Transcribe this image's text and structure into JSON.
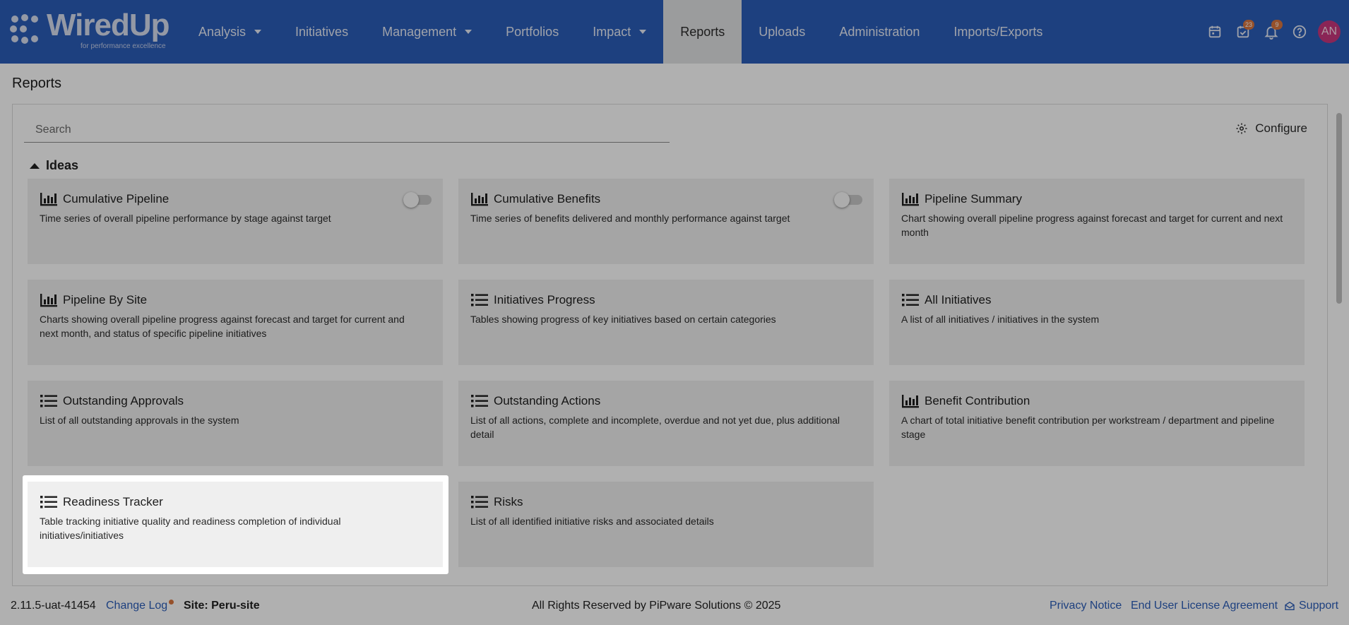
{
  "logo": {
    "name": "WiredUp",
    "tagline": "for performance excellence"
  },
  "nav": [
    {
      "label": "Analysis",
      "dropdown": true
    },
    {
      "label": "Initiatives",
      "dropdown": false
    },
    {
      "label": "Management",
      "dropdown": true
    },
    {
      "label": "Portfolios",
      "dropdown": false
    },
    {
      "label": "Impact",
      "dropdown": true
    },
    {
      "label": "Reports",
      "dropdown": false,
      "active": true
    },
    {
      "label": "Uploads",
      "dropdown": false
    },
    {
      "label": "Administration",
      "dropdown": false
    },
    {
      "label": "Imports/Exports",
      "dropdown": false
    }
  ],
  "header_icons": {
    "calendar": "calendar-icon",
    "tasks": {
      "icon": "task-check-icon",
      "count": "23"
    },
    "notifications": {
      "icon": "bell-icon",
      "count": "9"
    },
    "help": "help-icon",
    "avatar_initials": "AN"
  },
  "page": {
    "title": "Reports"
  },
  "search": {
    "placeholder": "Search",
    "value": ""
  },
  "configure_label": "Configure",
  "section": {
    "label": "Ideas",
    "expanded": true
  },
  "cards": [
    {
      "title": "Cumulative Pipeline",
      "description": "Time series of overall pipeline performance by stage against target",
      "icon": "bar-chart-icon",
      "toggle": true
    },
    {
      "title": "Cumulative Benefits",
      "description": "Time series of benefits delivered and monthly performance against target",
      "icon": "bar-chart-icon",
      "toggle": true
    },
    {
      "title": "Pipeline Summary",
      "description": "Chart showing overall pipeline progress against forecast and target for current and next month",
      "icon": "bar-chart-icon",
      "toggle": false
    },
    {
      "title": "Pipeline By Site",
      "description": "Charts showing overall pipeline progress against forecast and target for current and next month, and status of specific pipeline initiatives",
      "icon": "bar-chart-icon",
      "toggle": false
    },
    {
      "title": "Initiatives Progress",
      "description": "Tables showing progress of key initiatives based on certain categories",
      "icon": "list-icon",
      "toggle": false
    },
    {
      "title": "All Initiatives",
      "description": "A list of all initiatives / initiatives in the system",
      "icon": "list-icon",
      "toggle": false
    },
    {
      "title": "Outstanding Approvals",
      "description": "List of all outstanding approvals in the system",
      "icon": "list-icon",
      "toggle": false
    },
    {
      "title": "Outstanding Actions",
      "description": "List of all actions, complete and incomplete, overdue and not yet due, plus additional detail",
      "icon": "list-icon",
      "toggle": false
    },
    {
      "title": "Benefit Contribution",
      "description": "A chart of total initiative benefit contribution per workstream / department and pipeline stage",
      "icon": "bar-chart-icon",
      "toggle": false
    },
    {
      "title": "Readiness Tracker",
      "description": "Table tracking initiative quality and readiness completion of individual initiatives/initiatives",
      "icon": "list-icon",
      "toggle": false,
      "highlighted": true
    },
    {
      "title": "Risks",
      "description": "List of all identified initiative risks and associated details",
      "icon": "list-icon",
      "toggle": false
    }
  ],
  "footer": {
    "version": "2.11.5-uat-41454",
    "changelog": "Change Log",
    "site": "Site: Peru-site",
    "rights": "All Rights Reserved by PiPware Solutions © 2025",
    "privacy": "Privacy Notice",
    "eula": "End User License Agreement",
    "support": "Support"
  },
  "colors": {
    "header": "#2b5db9",
    "badge": "#d9763f",
    "avatar": "#c9367d",
    "link": "#2b5db9"
  }
}
